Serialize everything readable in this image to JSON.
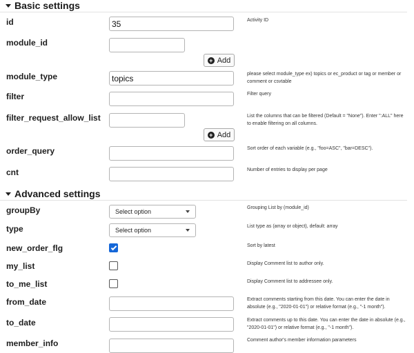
{
  "basic": {
    "title": "Basic settings",
    "fields": {
      "id": {
        "label": "id",
        "value": "35",
        "help": "Activity ID"
      },
      "module_id": {
        "label": "module_id",
        "value": "",
        "add_label": "Add",
        "help": ""
      },
      "module_type": {
        "label": "module_type",
        "value": "topics",
        "help": "please select module_type ex) topics or ec_product or tag or member or comment or csvtable"
      },
      "filter": {
        "label": "filter",
        "value": "",
        "help": "Filter query"
      },
      "filter_request_allow_list": {
        "label": "filter_request_allow_list",
        "value": "",
        "add_label": "Add",
        "help": "List the columns that can be filtered (Default = \"None\"). Enter \":ALL\" here to enable filtering on all columns."
      },
      "order_query": {
        "label": "order_query",
        "value": "",
        "help": "Sort order of each variable (e.g., \"foo=ASC\", \"bar=DESC\")."
      },
      "cnt": {
        "label": "cnt",
        "value": "",
        "help": "Number of entries to display per page"
      }
    }
  },
  "advanced": {
    "title": "Advanced settings",
    "fields": {
      "groupBy": {
        "label": "groupBy",
        "selected": "Select option",
        "help": "Grouping List by (module_id)"
      },
      "type": {
        "label": "type",
        "selected": "Select option",
        "help": "List type as (array or object), default: array"
      },
      "new_order_flg": {
        "label": "new_order_flg",
        "checked": true,
        "help": "Sort by latest"
      },
      "my_list": {
        "label": "my_list",
        "checked": false,
        "help": "Display Comment list to author only."
      },
      "to_me_list": {
        "label": "to_me_list",
        "checked": false,
        "help": "Display Comment list to addressee only."
      },
      "from_date": {
        "label": "from_date",
        "value": "",
        "help": "Extract comments starting from this date. You can enter the date in absolute (e.g., \"2020-01-01\") or relative format (e.g., \"-1 month\")."
      },
      "to_date": {
        "label": "to_date",
        "value": "",
        "help": "Extract comments up to this date. You can enter the date in absolute (e.g., \"2020-01-01\") or relative format (e.g., \"-1 month\")."
      },
      "member_info": {
        "label": "member_info",
        "value": "",
        "help": "Comment author's member information parameters"
      }
    }
  },
  "colors": {
    "accent": "#1567d8",
    "border": "#b3b3b3",
    "text": "#1e1e1e"
  },
  "icons": {
    "collapse": "caret-down-icon",
    "add": "plus-circle-icon",
    "dropdown": "chevron-down-icon",
    "check": "checkmark-icon"
  }
}
